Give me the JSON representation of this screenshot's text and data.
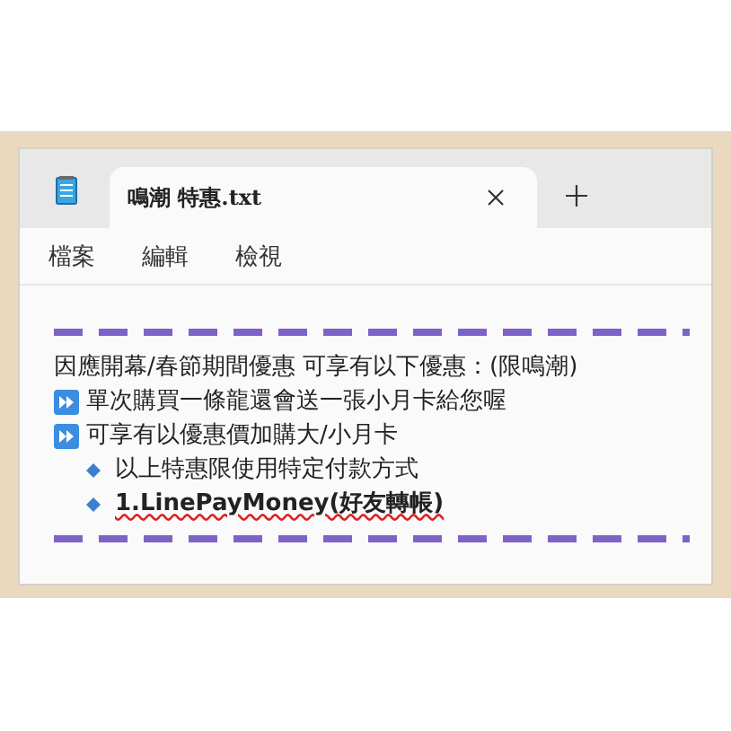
{
  "tabs": [
    {
      "label": "鳴潮 特惠.txt",
      "selected": true
    }
  ],
  "menu": [
    "檔案",
    "編輯",
    "檢視"
  ],
  "lines": [
    {
      "kind": "plain",
      "text": "因應開幕/春節期間優惠  可享有以下優惠：(限鳴潮)"
    },
    {
      "kind": "arrow",
      "text": "單次購買一條龍還會送一張小月卡給您喔"
    },
    {
      "kind": "arrow",
      "text": "可享有以優惠價加購大/小月卡",
      "children": [
        {
          "kind": "bullet",
          "text": "以上特惠限使用特定付款方式"
        },
        {
          "kind": "bullet",
          "text": "1.LinePayMoney(好友轉帳)",
          "misspelled": true
        }
      ]
    }
  ]
}
